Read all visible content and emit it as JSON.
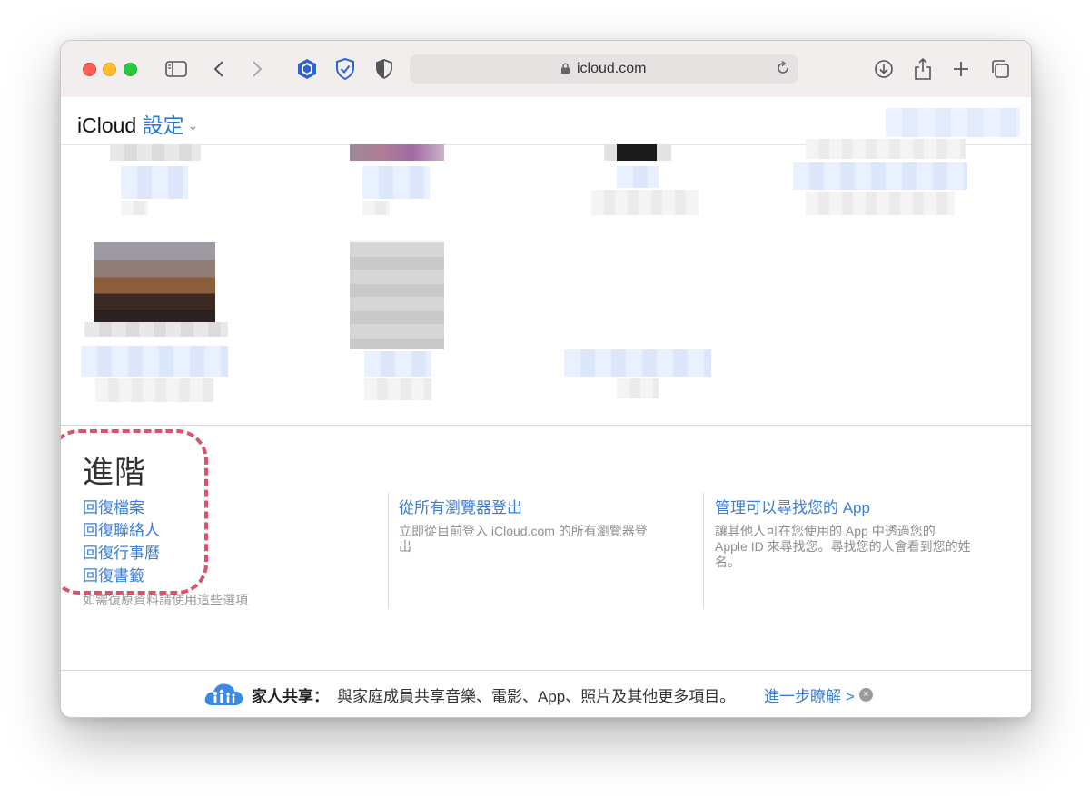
{
  "browser": {
    "url": "icloud.com"
  },
  "header": {
    "brand": "iCloud",
    "section": "設定"
  },
  "advanced": {
    "title": "進階",
    "links": [
      "回復檔案",
      "回復聯絡人",
      "回復行事曆",
      "回復書籤"
    ],
    "note": "如需復原資料請使用這些選項"
  },
  "columns": [
    {
      "title": "從所有瀏覽器登出",
      "desc_lines": [
        "立即從目前登入 iCloud.com 的所有瀏覽器登",
        "出"
      ]
    },
    {
      "title": "管理可以尋找您的 App",
      "desc_lines": [
        "讓其他人可在您使用的 App 中透過您的",
        "Apple ID 來尋找您。尋找您的人會看到您的姓",
        "名。"
      ]
    }
  ],
  "footer": {
    "label": "家人共享：",
    "text": "與家庭成員共享音樂、電影、App、照片及其他更多項目。",
    "link": "進一步瞭解 >",
    "close": "×"
  },
  "colors": {
    "link": "#3b7ed6",
    "highlight": "#d9536b",
    "traffic_red": "#fe5f57",
    "traffic_yellow": "#febc2e",
    "traffic_green": "#28c840"
  },
  "icons": [
    "sidebar-icon",
    "back-icon",
    "forward-icon",
    "extension-hex-icon",
    "shield-check-icon",
    "shield-half-icon",
    "lock-icon",
    "reload-icon",
    "download-icon",
    "share-icon",
    "plus-icon",
    "tabs-icon",
    "family-cloud-icon",
    "close-icon"
  ]
}
